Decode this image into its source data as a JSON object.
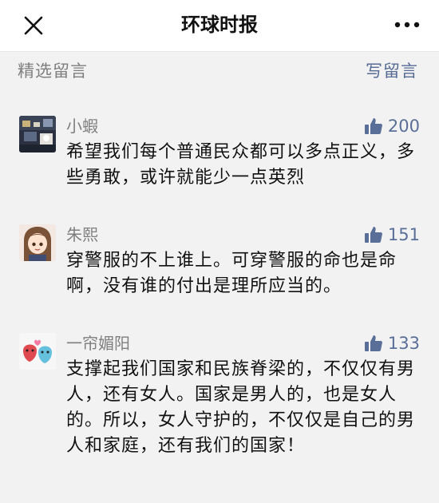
{
  "header": {
    "title": "环球时报",
    "close_icon": "close-icon",
    "more_icon": "more-dots-icon"
  },
  "section": {
    "title": "精选留言",
    "write_label": "写留言"
  },
  "colors": {
    "link": "#576b95",
    "like": "#5a6f98",
    "muted": "#7f7f7f",
    "background": "#f2f2f2"
  },
  "comments": [
    {
      "username": "小蝦",
      "likes": "200",
      "text": "希望我们每个普通民众都可以多点正义，多些勇敢，或许就能少一点英烈",
      "avatar": "avatar-night-photo"
    },
    {
      "username": "朱熙",
      "likes": "151",
      "text": "穿警服的不上谁上。可穿警服的命也是命啊，没有谁的付出是理所应当的。",
      "avatar": "avatar-anime-girl"
    },
    {
      "username": "一帘媚阳",
      "likes": "133",
      "text": "支撑起我们国家和民族脊梁的，不仅仅有男人，还有女人。国家是男人的，也是女人的。所以，女人守护的，不仅仅是自己的男人和家庭，还有我们的国家！",
      "avatar": "avatar-couple-faces"
    }
  ]
}
